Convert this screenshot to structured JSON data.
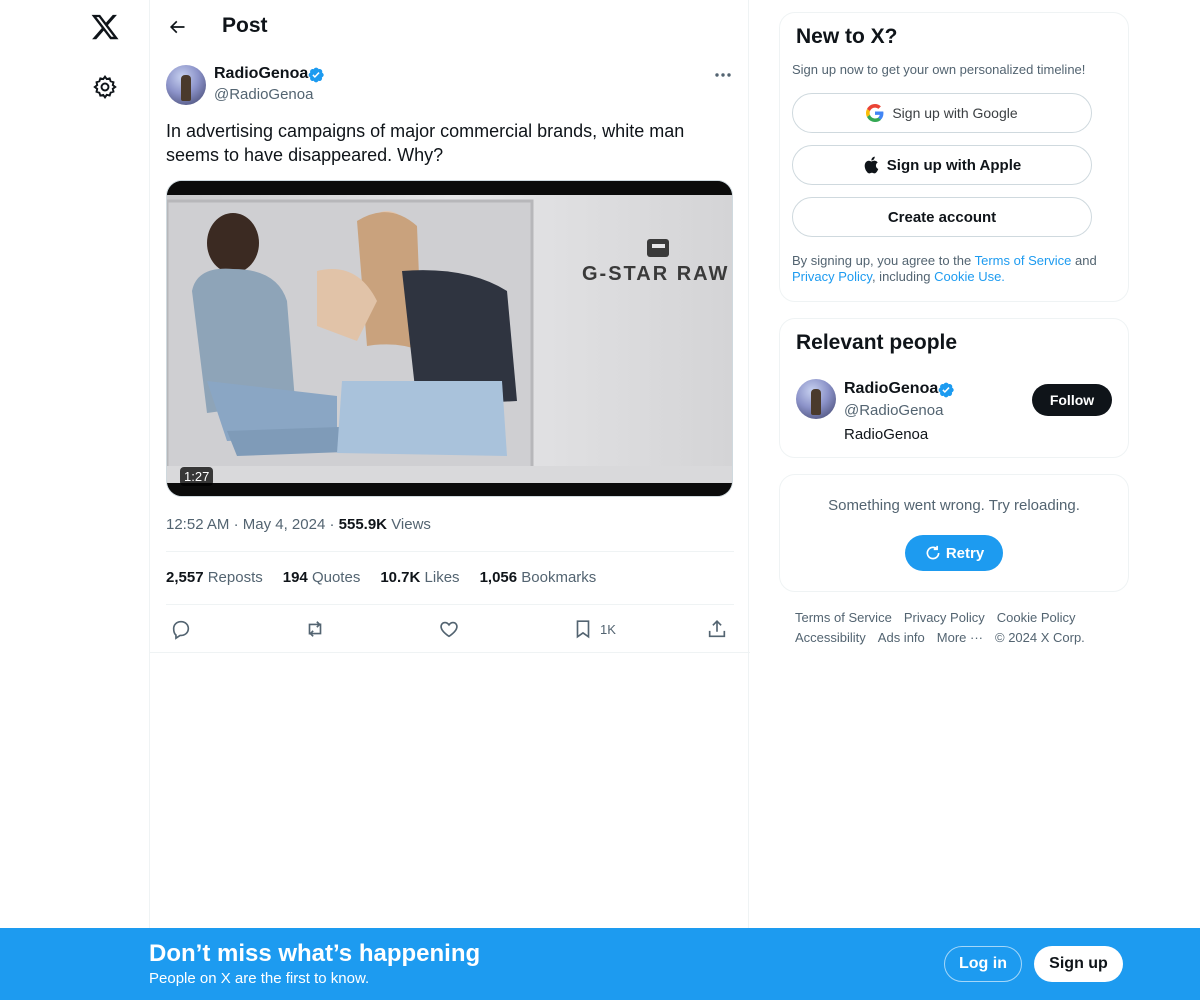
{
  "nav": {
    "logo_icon": "x-logo-icon",
    "settings_icon": "gear-icon"
  },
  "header": {
    "title": "Post",
    "back_icon": "arrow-left-icon"
  },
  "post": {
    "author_name": "RadioGenoa",
    "author_handle": "@RadioGenoa",
    "verified_icon": "verified-badge-icon",
    "text": "In advertising campaigns of major commercial brands, white man seems to have disappeared. Why?",
    "media": {
      "brand_text": "G-STAR RAW",
      "duration": "1:27"
    },
    "time": "12:52 AM",
    "date": "May 4, 2024",
    "views_count": "555.9K",
    "views_label": "Views",
    "stats": {
      "reposts_count": "2,557",
      "reposts_label": "Reposts",
      "quotes_count": "194",
      "quotes_label": "Quotes",
      "likes_count": "10.7K",
      "likes_label": "Likes",
      "bookmarks_count": "1,056",
      "bookmarks_label": "Bookmarks"
    },
    "actions": {
      "bookmark_count": "1K"
    }
  },
  "signup_card": {
    "title": "New to X?",
    "subtitle": "Sign up now to get your own personalized timeline!",
    "google_label": "Sign up with Google",
    "apple_label": "Sign up with Apple",
    "create_label": "Create account",
    "legal_prefix": "By signing up, you agree to the ",
    "terms_link": "Terms of Service",
    "legal_and": " and ",
    "privacy_link": "Privacy Policy",
    "legal_including": ", including ",
    "cookie_link": "Cookie Use."
  },
  "relevant_people": {
    "title": "Relevant people",
    "name": "RadioGenoa",
    "handle": "@RadioGenoa",
    "bio": "RadioGenoa",
    "follow_label": "Follow"
  },
  "error_card": {
    "message": "Something went wrong. Try reloading.",
    "retry_label": "Retry"
  },
  "footer": {
    "terms": "Terms of Service",
    "privacy": "Privacy Policy",
    "cookie": "Cookie Policy",
    "accessibility": "Accessibility",
    "ads": "Ads info",
    "more": "More ···",
    "copyright": "© 2024 X Corp."
  },
  "bottom_bar": {
    "title": "Don’t miss what’s happening",
    "subtitle": "People on X are the first to know.",
    "login_label": "Log in",
    "signup_label": "Sign up"
  },
  "colors": {
    "accent": "#1d9bf0",
    "text": "#0f1419",
    "muted": "#536471",
    "border": "#eff3f4"
  }
}
